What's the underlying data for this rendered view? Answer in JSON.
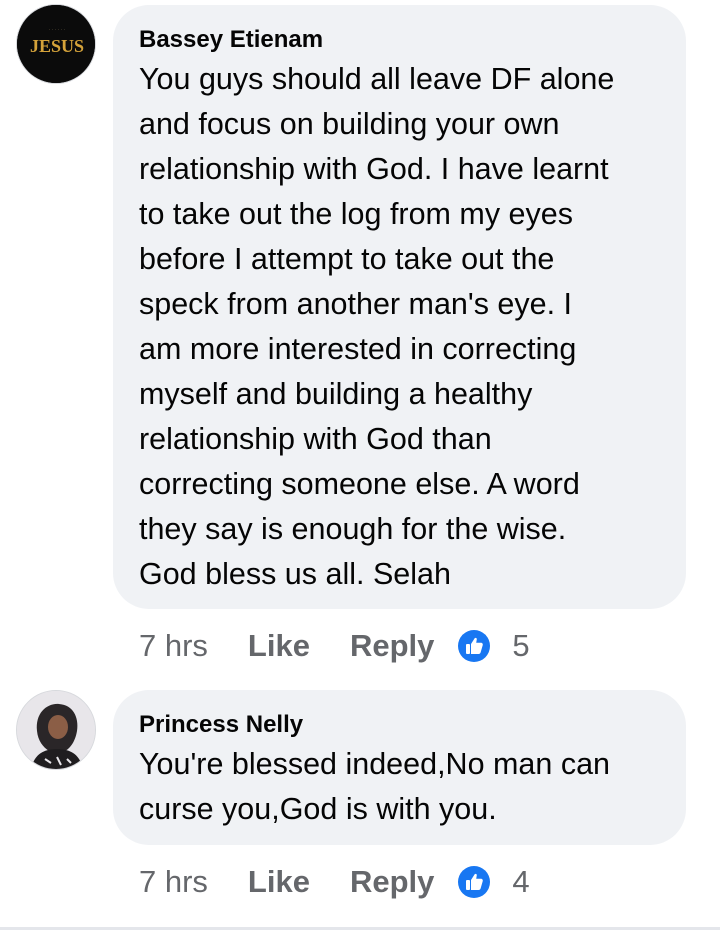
{
  "comments": [
    {
      "author": "Bassey Etienam",
      "avatar_text": "JESUS",
      "text": "You guys should all leave DF alone\nand focus on building your own\nrelationship with God. I have learnt\nto take out the log from my eyes\nbefore I attempt to take out the\nspeck from another man's eye. I\nam more interested in correcting\nmyself and building a healthy\nrelationship with God than\ncorrecting someone else. A word\nthey say is enough for the wise.\nGod bless us all. Selah",
      "time": "7 hrs",
      "like_label": "Like",
      "reply_label": "Reply",
      "reaction_icon": "thumbs-up-icon",
      "reaction_count": "5"
    },
    {
      "author": "Princess Nelly",
      "text": "You're blessed indeed,No man can\ncurse you,God is with you.",
      "time": "7 hrs",
      "like_label": "Like",
      "reply_label": "Reply",
      "reaction_icon": "thumbs-up-icon",
      "reaction_count": "4"
    }
  ],
  "colors": {
    "bubble": "#f0f2f5",
    "meta_text": "#65676b",
    "like_blue": "#1877f2",
    "avatar1_bg": "#0b0b0b",
    "avatar1_gold": "#d4a23a"
  }
}
